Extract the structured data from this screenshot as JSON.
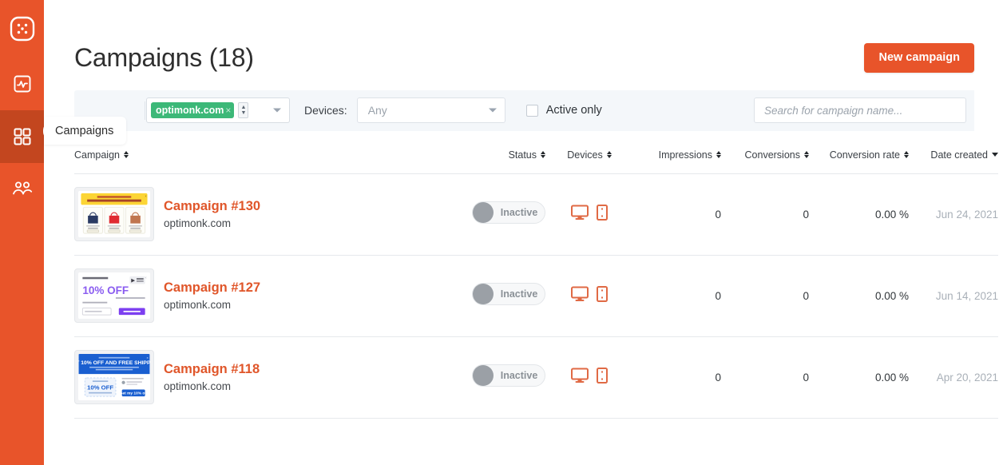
{
  "sidebar": {
    "items": [
      {
        "name": "logo",
        "icon": "app-logo-icon",
        "label": "OptiMonk"
      },
      {
        "name": "analytics",
        "icon": "analytics-icon",
        "label": "Analytics"
      },
      {
        "name": "campaigns",
        "icon": "grid-icon",
        "label": "Campaigns",
        "active": true
      },
      {
        "name": "audience",
        "icon": "people-icon",
        "label": "Audience"
      }
    ],
    "flyout_label": "Campaigns"
  },
  "header": {
    "title": "Campaigns (18)",
    "new_campaign_label": "New campaign"
  },
  "filters": {
    "domain_tag": "optimonk.com",
    "domain_tag_remove": "×",
    "devices_label": "Devices:",
    "devices_value": "Any",
    "active_only_label": "Active only",
    "active_only_checked": false,
    "search_placeholder": "Search for campaign name..."
  },
  "table": {
    "columns": [
      {
        "key": "campaign",
        "label": "Campaign",
        "sort": "both"
      },
      {
        "key": "status",
        "label": "Status",
        "sort": "both"
      },
      {
        "key": "devices",
        "label": "Devices",
        "sort": "both"
      },
      {
        "key": "impressions",
        "label": "Impressions",
        "sort": "both"
      },
      {
        "key": "conversions",
        "label": "Conversions",
        "sort": "both"
      },
      {
        "key": "conversion_rate",
        "label": "Conversion rate",
        "sort": "both"
      },
      {
        "key": "date_created",
        "label": "Date created",
        "sort": "desc"
      }
    ],
    "rows": [
      {
        "name": "Campaign #130",
        "domain": "optimonk.com",
        "status": "Inactive",
        "devices": [
          "desktop",
          "mobile"
        ],
        "impressions": "0",
        "conversions": "0",
        "conversion_rate": "0.00 %",
        "date_created": "Jun 24, 2021",
        "thumb": "products"
      },
      {
        "name": "Campaign #127",
        "domain": "optimonk.com",
        "status": "Inactive",
        "devices": [
          "desktop",
          "mobile"
        ],
        "impressions": "0",
        "conversions": "0",
        "conversion_rate": "0.00 %",
        "date_created": "Jun 14, 2021",
        "thumb": "ten-percent"
      },
      {
        "name": "Campaign #118",
        "domain": "optimonk.com",
        "status": "Inactive",
        "devices": [
          "desktop",
          "mobile"
        ],
        "impressions": "0",
        "conversions": "0",
        "conversion_rate": "0.00 %",
        "date_created": "Apr 20, 2021",
        "thumb": "free-shipping"
      }
    ]
  },
  "colors": {
    "brand": "#e8542a",
    "brand_dark": "#c3461f",
    "tag_green": "#3cb878",
    "filter_bg": "#f4f7fa"
  }
}
